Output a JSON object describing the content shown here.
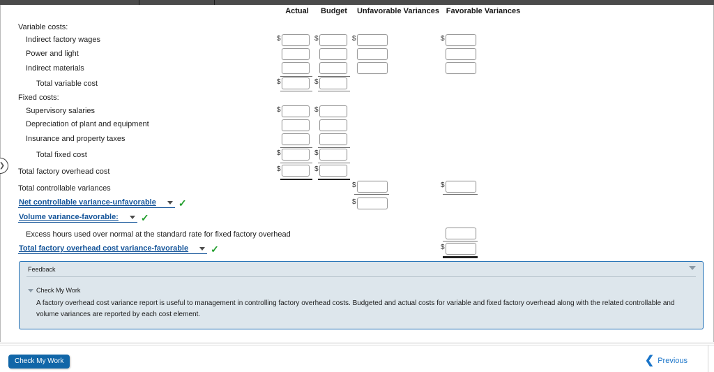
{
  "window": {
    "topbar_dividers": 2
  },
  "left_handle": {
    "icon": "chevron-right-icon"
  },
  "table": {
    "columns": [
      {
        "key": "actual",
        "label": "Actual"
      },
      {
        "key": "budget",
        "label": "Budget"
      },
      {
        "key": "unfavorable",
        "label": "Unfavorable Variances"
      },
      {
        "key": "favorable",
        "label": "Favorable Variances"
      }
    ],
    "rows": [
      {
        "label": "Variable costs:",
        "indent": 0,
        "type": "section"
      },
      {
        "label": "Indirect factory wages",
        "indent": 1,
        "type": "input",
        "cells": {
          "actual": "",
          "budget": "",
          "unfavorable": "",
          "favorable": ""
        },
        "dollar": {
          "actual": "$",
          "budget": "$",
          "unfavorable": "$",
          "favorable": "$"
        }
      },
      {
        "label": "Power and light",
        "indent": 1,
        "type": "input",
        "cells": {
          "actual": "",
          "budget": "",
          "unfavorable": "",
          "favorable": ""
        }
      },
      {
        "label": "Indirect materials",
        "indent": 1,
        "type": "input",
        "cells": {
          "actual": "",
          "budget": "",
          "unfavorable": "",
          "favorable": ""
        }
      },
      {
        "label": "Total variable cost",
        "indent": 2,
        "type": "total",
        "cells": {
          "actual": "",
          "budget": ""
        },
        "dollar": {
          "actual": "$",
          "budget": "$"
        }
      },
      {
        "label": "Fixed costs:",
        "indent": 0,
        "type": "section"
      },
      {
        "label": "Supervisory salaries",
        "indent": 1,
        "type": "input",
        "cells": {
          "actual": "",
          "budget": ""
        },
        "dollar": {
          "actual": "$",
          "budget": "$"
        }
      },
      {
        "label": "Depreciation of plant and equipment",
        "indent": 1,
        "type": "input",
        "cells": {
          "actual": "",
          "budget": ""
        }
      },
      {
        "label": "Insurance and property taxes",
        "indent": 1,
        "type": "input",
        "cells": {
          "actual": "",
          "budget": ""
        }
      },
      {
        "label": "Total fixed cost",
        "indent": 2,
        "type": "total",
        "cells": {
          "actual": "",
          "budget": ""
        },
        "dollar": {
          "actual": "$",
          "budget": "$"
        }
      },
      {
        "label": "Total factory overhead cost",
        "indent": 0,
        "type": "total",
        "cells": {
          "actual": "",
          "budget": ""
        },
        "dollar": {
          "actual": "$",
          "budget": "$"
        }
      },
      {
        "label": "Total controllable variances",
        "indent": 0,
        "type": "input",
        "cells": {
          "unfavorable": "",
          "favorable": ""
        },
        "dollar": {
          "unfavorable": "$",
          "favorable": "$"
        }
      },
      {
        "label": "Excess hours used over normal at the standard rate for fixed factory overhead",
        "indent": 1,
        "type": "input",
        "cells": {
          "favorable": ""
        }
      }
    ],
    "labels": {
      "variable_costs": "Variable costs:",
      "indirect_factory_wages": "Indirect factory wages",
      "power_and_light": "Power and light",
      "indirect_materials": "Indirect materials",
      "total_variable_cost": "Total variable cost",
      "fixed_costs": "Fixed costs:",
      "supervisory_salaries": "Supervisory salaries",
      "depreciation": "Depreciation of plant and equipment",
      "insurance": "Insurance and property taxes",
      "total_fixed_cost": "Total fixed cost",
      "total_factory_overhead_cost": "Total factory overhead cost",
      "total_controllable_variances": "Total controllable variances",
      "excess_hours": "Excess hours used over normal at the standard rate for fixed factory overhead"
    },
    "dollar_sign": "$"
  },
  "dropdowns": [
    {
      "id": "net-controllable-variance",
      "label": "Net controllable variance-unfavorable",
      "status": "correct",
      "check": "✓"
    },
    {
      "id": "volume-variance",
      "label": "Volume variance-favorable:",
      "status": "correct",
      "check": "✓"
    },
    {
      "id": "total-factory-overhead-cost-variance",
      "label": "Total factory overhead cost variance-favorable",
      "status": "correct",
      "check": "✓"
    }
  ],
  "feedback": {
    "title": "Feedback",
    "check_my_work_label": "Check My Work",
    "body": "A factory overhead cost variance report is useful to management in controlling factory overhead costs. Budgeted and actual costs for variable and fixed factory overhead along with the related controllable and volume variances are reported by each cost element.",
    "collapse_icon": "caret-down-icon",
    "expand_icon": "caret-down-icon"
  },
  "toolbar": {
    "check_my_work_button": "Check My Work",
    "previous_label": "Previous",
    "previous_icon": "chevron-left-icon"
  },
  "colors": {
    "link_blue": "#15559a",
    "button_blue": "#1166a8",
    "previous_blue": "#1974c9",
    "check_green": "#1f9d2a",
    "feedback_bg": "#dde6ec",
    "feedback_border": "#1f6fb5",
    "topbar": "#4b4b4b"
  }
}
